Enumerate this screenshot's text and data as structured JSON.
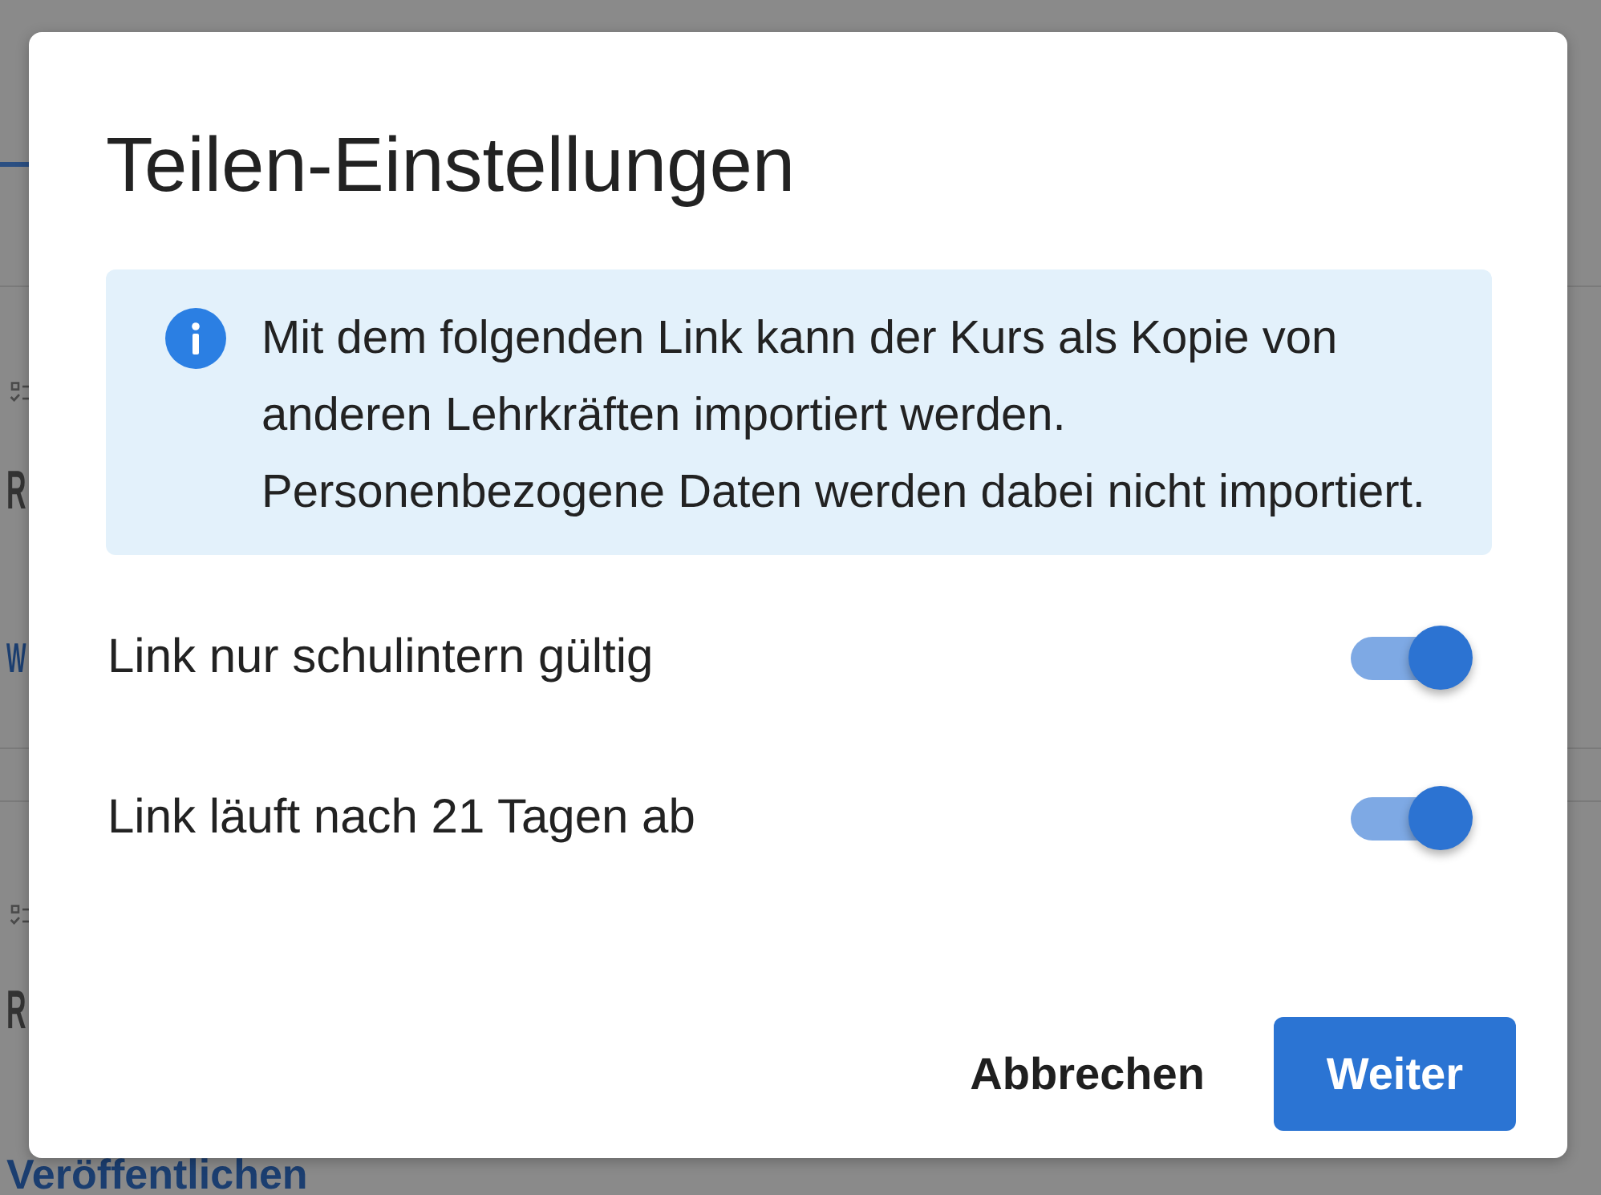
{
  "page": {
    "sections": [
      {
        "heading": "R",
        "link": "W"
      },
      {
        "heading": "R",
        "link": "Veröffentlichen"
      }
    ]
  },
  "dialog": {
    "title": "Teilen-Einstellungen",
    "info": {
      "paragraphs": [
        "Mit dem folgenden Link kann der Kurs als Kopie von anderen Lehrkräften importiert werden.",
        "Personenbezogene Daten werden dabei nicht importiert."
      ]
    },
    "settings": [
      {
        "label": "Link nur schulintern gültig",
        "on": true
      },
      {
        "label": "Link läuft nach 21 Tagen ab",
        "on": true
      }
    ],
    "buttons": [
      {
        "label": "Abbrechen",
        "kind": "text"
      },
      {
        "label": "Weiter",
        "kind": "primary"
      }
    ]
  }
}
